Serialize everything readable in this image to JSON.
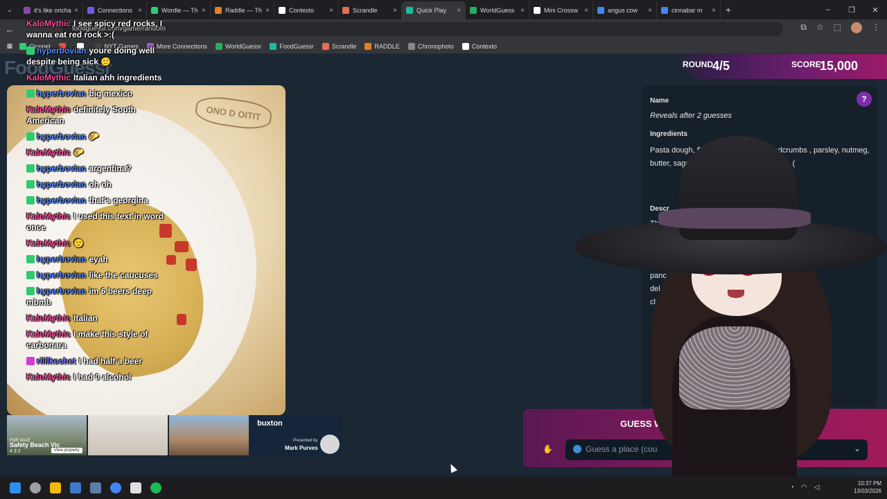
{
  "browser": {
    "tabs": [
      {
        "label": "it's like orichalcum its js",
        "color": "#8e44ad"
      },
      {
        "label": "Connections",
        "color": "#6c5ce7"
      },
      {
        "label": "Wordle — Th",
        "color": "#2ecc71"
      },
      {
        "label": "Raddle — Th",
        "color": "#e67e22"
      },
      {
        "label": "Contexto",
        "color": "#ffffff"
      },
      {
        "label": "Scrandle",
        "color": "#e17055"
      },
      {
        "label": "Quick Play",
        "color": "#1abc9c",
        "active": true
      },
      {
        "label": "WorldGuess",
        "color": "#27ae60"
      },
      {
        "label": "Mini Crossw",
        "color": "#ffffff"
      },
      {
        "label": "angus cow",
        "color": "#4285f4"
      },
      {
        "label": "cinnabar m",
        "color": "#4285f4"
      }
    ],
    "url": "foodguessr.com/game/random",
    "bookmarks": [
      {
        "label": "Cinnnel",
        "color": "#2ecc71"
      },
      {
        "label": "",
        "color": "#e74c3c"
      },
      {
        "label": "",
        "color": "#ffffff"
      },
      {
        "label": "NYT Games",
        "color": "#444"
      },
      {
        "label": "More Connections",
        "color": "#9b59b6"
      },
      {
        "label": "WorldGuessr",
        "color": "#27ae60"
      },
      {
        "label": "FoodGuessr",
        "color": "#1abc9c"
      },
      {
        "label": "Scrandle",
        "color": "#e17055"
      },
      {
        "label": "RADDLE",
        "color": "#e67e22"
      },
      {
        "label": "Chronophoto",
        "color": "#888"
      },
      {
        "label": "Contexto",
        "color": "#ffffff"
      }
    ]
  },
  "game": {
    "logo": "FoodGuessr",
    "round_label": "ROUND",
    "round_value": "4/5",
    "score_label": "SCORE",
    "score_value": "15,000",
    "name_label": "Name",
    "name_value": "Reveals after 2 guesses",
    "ingredients_label": "Ingredients",
    "ingredients_value": "Pasta dough, flo               rk, ground beef, breadcrumbs                  , parsley, nutmeg, butter, sage                    , (optional) amaretto cookies, (",
    "description_label": "Descr",
    "description_value": "Th                                      aped like a",
    "description_value2": "panc                                   ers a",
    "description_value3": "del                                     dying",
    "description_value4": "cl",
    "guess_title": "GUESS WH",
    "guess_placeholder": "Guess a place (cou",
    "help_symbol": "?",
    "plate_stamp": "ONO D OITIT"
  },
  "chat": [
    {
      "user": "KaloMythic",
      "text": "I see spicy red rocks, I wanna eat red rock >:(",
      "color": "#ff4fa0"
    },
    {
      "user": "hyperbovian",
      "text": "youre doing well despite being sick 🙂",
      "color": "#5b8cff"
    },
    {
      "user": "KaloMythic",
      "text": "Italian ahh ingredients",
      "color": "#ff4fa0"
    },
    {
      "user": "hyperbovian",
      "text": "big mexico",
      "color": "#5b8cff"
    },
    {
      "user": "KaloMythic",
      "text": "definitely South American",
      "color": "#ff4fa0"
    },
    {
      "user": "hyperbovian",
      "text": "🌮",
      "color": "#5b8cff"
    },
    {
      "user": "KaloMythic",
      "text": "🌮",
      "color": "#ff4fa0"
    },
    {
      "user": "hyperbovian",
      "text": "argentina?",
      "color": "#5b8cff"
    },
    {
      "user": "hyperbovian",
      "text": "oh oh",
      "color": "#5b8cff"
    },
    {
      "user": "hyperbovian",
      "text": "that's georgina",
      "color": "#5b8cff"
    },
    {
      "user": "KaloMythic",
      "text": "I used this text in word once",
      "color": "#ff4fa0"
    },
    {
      "user": "KaloMythic",
      "text": "",
      "color": "#ff4fa0"
    },
    {
      "user": "hyperbovian",
      "text": "eyah",
      "color": "#5b8cff"
    },
    {
      "user": "hyperbovian",
      "text": "like the caucuses",
      "color": "#5b8cff"
    },
    {
      "user": "hyperbovian",
      "text": "im 6 beers deep mbmb",
      "color": "#5b8cff"
    },
    {
      "user": "KaloMythic",
      "text": "Italian",
      "color": "#ff4fa0"
    },
    {
      "user": "KaloMythic",
      "text": "I make this style of carbonara",
      "color": "#ff4fa0"
    },
    {
      "user": "rililkochet",
      "text": "I had half a beer",
      "color": "#7d7dff"
    },
    {
      "user": "KaloMythic",
      "text": "I had 0 alcohol",
      "color": "#ff4fa0"
    }
  ],
  "ads": {
    "ad1_caption": "Safety Beach Vic",
    "ad1_forsale": "FOR SALE",
    "ad1_meta": "4  3  2",
    "ad1_view": "View property",
    "ad4_brand": "buxton",
    "ad4_presented": "Presented by",
    "ad4_agent": "Mark Purves"
  },
  "taskbar": {
    "time": "10:37 PM",
    "date": "13/03/2026"
  }
}
